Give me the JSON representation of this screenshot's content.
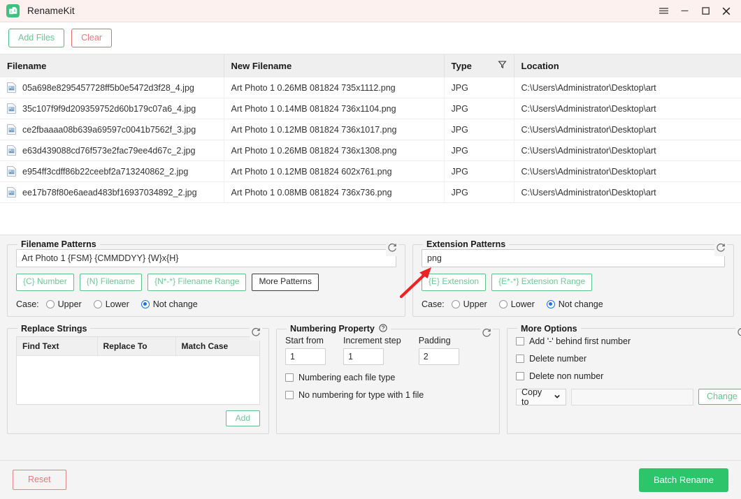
{
  "window": {
    "title": "RenameKit",
    "app_icon": "rename-app-icon",
    "controls": [
      {
        "name": "menu-icon",
        "glyph": "hamburger"
      },
      {
        "name": "minimize-icon",
        "glyph": "minimize"
      },
      {
        "name": "maximize-icon",
        "glyph": "maximize"
      },
      {
        "name": "close-icon",
        "glyph": "close"
      }
    ]
  },
  "toolbar": {
    "add_files_label": "Add Files",
    "clear_label": "Clear"
  },
  "file_table": {
    "columns": [
      "Filename",
      "New Filename",
      "Type",
      "Location"
    ],
    "filter_icon": "filter-icon",
    "rows": [
      {
        "filename": "05a698e8295457728ff5b0e5472d3f28_4.jpg",
        "new_filename": "Art Photo 1 0.26MB 081824 735x1112.png",
        "type": "JPG",
        "location": "C:\\Users\\Administrator\\Desktop\\art"
      },
      {
        "filename": "35c107f9f9d209359752d60b179c07a6_4.jpg",
        "new_filename": "Art Photo 1 0.14MB 081824 736x1104.png",
        "type": "JPG",
        "location": "C:\\Users\\Administrator\\Desktop\\art"
      },
      {
        "filename": "ce2fbaaaa08b639a69597c0041b7562f_3.jpg",
        "new_filename": "Art Photo 1 0.12MB 081824 736x1017.png",
        "type": "JPG",
        "location": "C:\\Users\\Administrator\\Desktop\\art"
      },
      {
        "filename": "e63d439088cd76f573e2fac79ee4d67c_2.jpg",
        "new_filename": "Art Photo 1 0.26MB 081824 736x1308.png",
        "type": "JPG",
        "location": "C:\\Users\\Administrator\\Desktop\\art"
      },
      {
        "filename": "e954ff3cdff86b22ceebf2a713240862_2.jpg",
        "new_filename": "Art Photo 1 0.12MB 081824 602x761.png",
        "type": "JPG",
        "location": "C:\\Users\\Administrator\\Desktop\\art"
      },
      {
        "filename": "ee17b78f80e6aead483bf16937034892_2.jpg",
        "new_filename": "Art Photo 1 0.08MB 081824 736x736.png",
        "type": "JPG",
        "location": "C:\\Users\\Administrator\\Desktop\\art"
      }
    ]
  },
  "filename_patterns": {
    "title": "Filename Patterns",
    "input_value": "Art Photo 1 {FSM} {CMMDDYY} {W}x{H}",
    "chips": [
      {
        "label": "{C} Number"
      },
      {
        "label": "{N} Filename"
      },
      {
        "label": "{N*-*} Filename Range"
      },
      {
        "label": "More Patterns"
      }
    ],
    "case_label": "Case:",
    "case_options": [
      "Upper",
      "Lower",
      "Not change"
    ],
    "case_selected": "Not change"
  },
  "extension_patterns": {
    "title": "Extension Patterns",
    "input_value": "png",
    "chips": [
      {
        "label": "{E} Extension"
      },
      {
        "label": "{E*-*} Extension Range"
      }
    ],
    "case_label": "Case:",
    "case_options": [
      "Upper",
      "Lower",
      "Not change"
    ],
    "case_selected": "Not change"
  },
  "replace_strings": {
    "title": "Replace Strings",
    "columns": [
      "Find Text",
      "Replace To",
      "Match Case"
    ],
    "rows": [],
    "add_label": "Add"
  },
  "numbering_property": {
    "title": "Numbering Property",
    "help_icon": "help-icon",
    "fields": [
      {
        "label": "Start from",
        "value": "1"
      },
      {
        "label": "Increment step",
        "value": "1"
      },
      {
        "label": "Padding",
        "value": "2"
      }
    ],
    "checkboxes": [
      {
        "label": "Numbering each file type",
        "checked": false
      },
      {
        "label": "No numbering for type with 1 file",
        "checked": false
      }
    ]
  },
  "more_options": {
    "title": "More Options",
    "checkboxes": [
      {
        "label": "Add '-' behind first number",
        "checked": false
      },
      {
        "label": "Delete number",
        "checked": false
      },
      {
        "label": "Delete non number",
        "checked": false
      }
    ],
    "select_value": "Copy to",
    "path_value": "",
    "change_label": "Change"
  },
  "bottom_bar": {
    "reset_label": "Reset",
    "batch_rename_label": "Batch Rename"
  },
  "annotation": {
    "arrow": "red-arrow-pointing-to-extension-input",
    "color": "#ee2222"
  },
  "colors": {
    "accent_green": "#2ec469",
    "chip_green": "#5cc389",
    "danger_red": "#e38585",
    "titlebar_bg": "#fdf1ef",
    "panel_bg": "#f4f4f4"
  }
}
